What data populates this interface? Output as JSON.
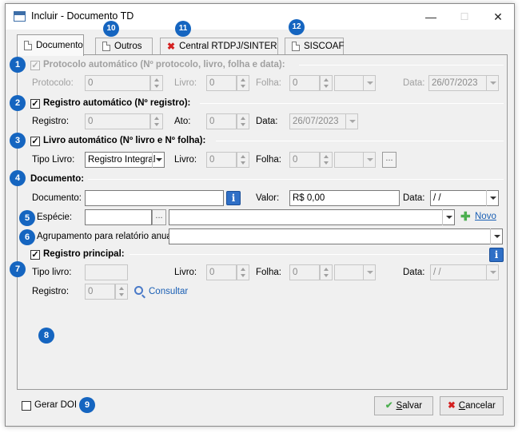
{
  "window": {
    "title": "Incluir - Documento TD",
    "minimize": "—",
    "maximize": "☐",
    "close": "✕"
  },
  "tabs": [
    {
      "label": "Documento",
      "icon": "document-icon"
    },
    {
      "label": "Outros",
      "icon": "document-icon"
    },
    {
      "label": "Central RTDPJ/SINTER",
      "icon": "error-x-icon"
    },
    {
      "label": "SISCOAF",
      "icon": "document-icon"
    }
  ],
  "badges": {
    "b1": "1",
    "b2": "2",
    "b3": "3",
    "b4": "4",
    "b5": "5",
    "b6": "6",
    "b7": "7",
    "b8": "8",
    "b9": "9",
    "b10": "10",
    "b11": "11",
    "b12": "12"
  },
  "protocolo_auto": {
    "title": "Protocolo automático (Nº protocolo, livro, folha e data):",
    "checked": true,
    "enabled": false,
    "protocolo_label": "Protocolo:",
    "protocolo_value": "0",
    "livro_label": "Livro:",
    "livro_value": "0",
    "folha_label": "Folha:",
    "folha_value": "0",
    "data_label": "Data:",
    "data_value": "26/07/2023"
  },
  "registro_auto": {
    "title": "Registro automático (Nº registro):",
    "checked": true,
    "registro_label": "Registro:",
    "registro_value": "0",
    "ato_label": "Ato:",
    "ato_value": "0",
    "data_label": "Data:",
    "data_value": "26/07/2023"
  },
  "livro_auto": {
    "title": "Livro automático (Nº livro e Nº folha):",
    "checked": true,
    "tipo_label": "Tipo Livro:",
    "tipo_value": "Registro Integral",
    "livro_label": "Livro:",
    "livro_value": "0",
    "folha_label": "Folha:",
    "folha_value": "0",
    "more_button": "..."
  },
  "documento": {
    "title": "Documento:",
    "documento_label": "Documento:",
    "documento_value": "",
    "info_button": "i",
    "valor_label": "Valor:",
    "valor_value": "R$ 0,00",
    "data_label": "Data:",
    "data_value": " / /"
  },
  "especie": {
    "label": "Espécie:",
    "code_value": "",
    "more_button": "...",
    "desc_value": "",
    "novo_link": "Novo"
  },
  "agrupamento": {
    "label": "Agrupamento para relatório anual:",
    "value": ""
  },
  "registro_principal": {
    "title": "Registro principal:",
    "checked": true,
    "tipo_label": "Tipo livro:",
    "tipo_value": "",
    "livro_label": "Livro:",
    "livro_value": "0",
    "folha_label": "Folha:",
    "folha_value": "0",
    "data_label": "Data:",
    "data_value": " / /",
    "registro_label": "Registro:",
    "registro_value": "0",
    "consultar_link": "Consultar",
    "info_button": "i"
  },
  "footer": {
    "gerar_doi_label": "Gerar DOI",
    "gerar_doi_checked": false,
    "salvar_prefix": "",
    "salvar_underline": "S",
    "salvar_rest": "alvar",
    "cancelar_underline": "C",
    "cancelar_rest": "ancelar"
  },
  "colors": {
    "badge": "#1565c0",
    "link": "#1a5fb4",
    "info": "#2f6fc6"
  }
}
